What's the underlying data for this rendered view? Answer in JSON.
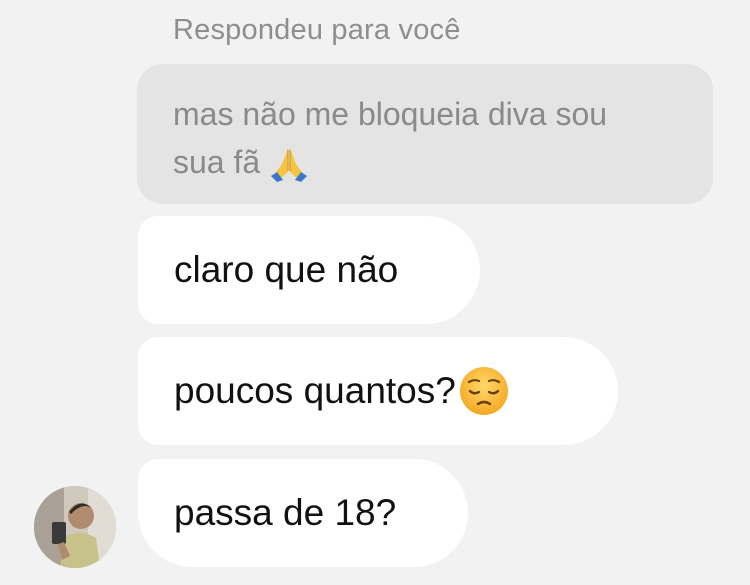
{
  "reply": {
    "header": "Respondeu para você",
    "quoted_line1": "mas não me bloqueia diva sou",
    "quoted_line2": "sua fã",
    "quoted_emoji": "folded-hands-icon"
  },
  "messages": [
    {
      "text": "claro que não"
    },
    {
      "text": "poucos quantos?",
      "emoji": "pensive-face-icon"
    },
    {
      "text": "passa de 18?"
    }
  ],
  "avatar": {
    "icon": "contact-avatar"
  },
  "colors": {
    "background": "#f2f2f2",
    "quoted_bubble": "#e4e4e4",
    "incoming_bubble": "#ffffff",
    "muted_text": "#8e8e8e",
    "message_text": "#111111"
  }
}
